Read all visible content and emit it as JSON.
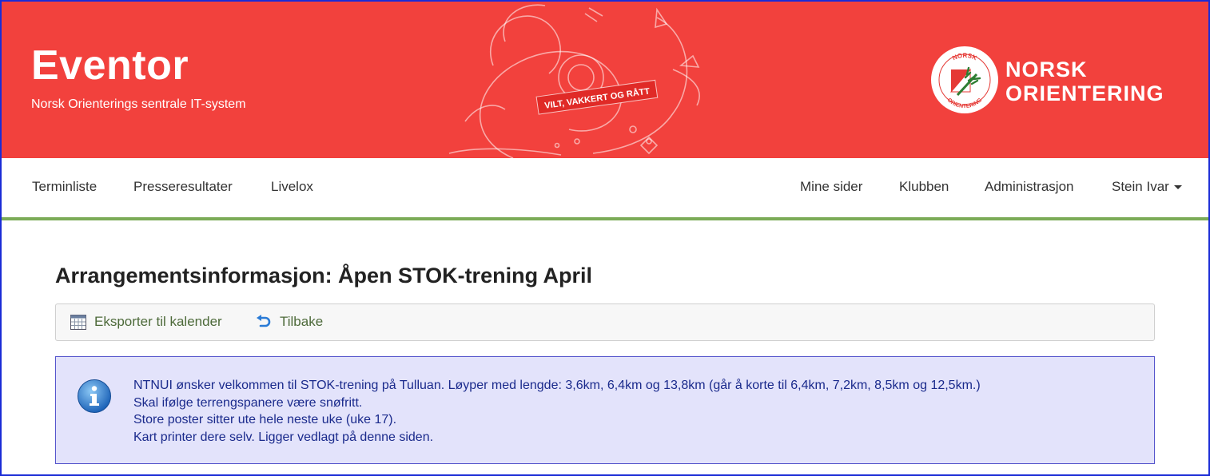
{
  "header": {
    "title": "Eventor",
    "subtitle": "Norsk Orienterings sentrale IT-system",
    "slogan": "VILT, VAKKERT OG RÅTT",
    "logo_ring_top": "NORSK",
    "logo_ring_bottom": "ORIENTERING",
    "logo_text_line1": "NORSK",
    "logo_text_line2": "ORIENTERING",
    "bg_color": "#f2413d"
  },
  "nav": {
    "left": [
      "Terminliste",
      "Presseresultater",
      "Livelox"
    ],
    "right": [
      "Mine sider",
      "Klubben",
      "Administrasjon"
    ],
    "user": "Stein Ivar",
    "accent_color": "#7bab57"
  },
  "main": {
    "title": "Arrangementsinformasjon: Åpen STOK-trening April",
    "toolbar": {
      "export_label": "Eksporter til kalender",
      "export_icon": "calendar-icon",
      "back_label": "Tilbake",
      "back_icon": "undo-arrow-icon"
    },
    "info": {
      "icon": "info-icon",
      "lines": [
        "NTNUI ønsker velkommen til STOK-trening på Tulluan. Løyper med lengde: 3,6km, 6,4km og 13,8km (går å korte til 6,4km, 7,2km, 8,5km og 12,5km.)",
        "Skal ifølge terrengspanere være snøfritt.",
        "Store poster sitter ute hele neste uke (uke 17).",
        "Kart printer dere selv. Ligger vedlagt på denne siden."
      ]
    }
  }
}
